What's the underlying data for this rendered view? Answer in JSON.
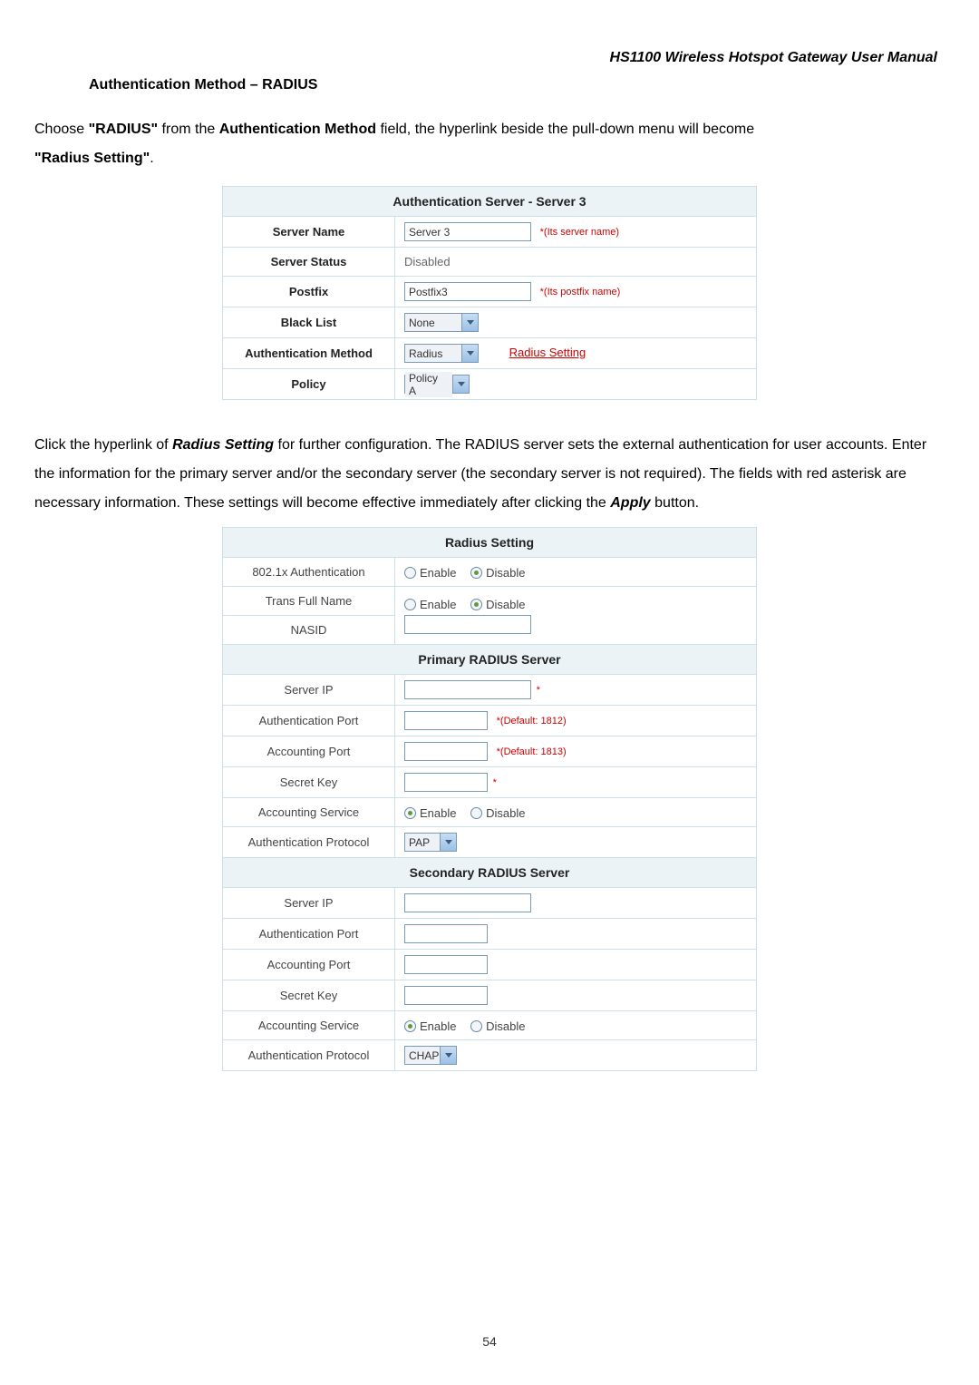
{
  "doc_title": "HS1100  Wireless  Hotspot  Gateway  User  Manual",
  "section_title": "Authentication Method – RADIUS",
  "para1_a": "Choose ",
  "para1_b": "\"RADIUS\"",
  "para1_c": " from the ",
  "para1_d": "Authentication Method",
  "para1_e": " field, the hyperlink beside the pull-down menu will become ",
  "para1_f": "\"Radius Setting\"",
  "para1_g": ".",
  "table1": {
    "header": "Authentication Server - Server 3",
    "rows": {
      "server_name_label": "Server Name",
      "server_name_value": "Server 3",
      "server_name_hint": "*(Its server name)",
      "server_status_label": "Server Status",
      "server_status_value": "Disabled",
      "postfix_label": "Postfix",
      "postfix_value": "Postfix3",
      "postfix_hint": "*(Its postfix name)",
      "black_list_label": "Black List",
      "black_list_value": "None",
      "auth_method_label": "Authentication Method",
      "auth_method_value": "Radius",
      "auth_method_link": "Radius Setting",
      "policy_label": "Policy",
      "policy_value": "Policy A"
    }
  },
  "para2_a": "Click the hyperlink of ",
  "para2_b": "Radius Setting",
  "para2_c": " for further configuration. The RADIUS server sets the external authentication for user accounts. Enter the information for the primary server and/or the secondary server (the secondary server is not required). The fields with red asterisk are necessary information. These settings will become effective immediately after clicking the ",
  "para2_d": "Apply",
  "para2_e": " button.",
  "table2": {
    "header": "Radius Setting",
    "auth_8021x_label": "802.1x Authentication",
    "enable_label": "Enable",
    "disable_label": "Disable",
    "trans_full_name_label": "Trans Full Name",
    "nasid_label": "NASID",
    "primary_header": "Primary RADIUS Server",
    "server_ip_label": "Server IP",
    "asterisk": "*",
    "auth_port_label": "Authentication Port",
    "auth_port_hint": "*(Default: 1812)",
    "acct_port_label": "Accounting Port",
    "acct_port_hint": "*(Default: 1813)",
    "secret_key_label": "Secret Key",
    "secret_key_hint": "*",
    "acct_service_label": "Accounting Service",
    "auth_protocol_label": "Authentication Protocol",
    "pap_value": "PAP",
    "secondary_header": "Secondary RADIUS Server",
    "chap_value": "CHAP"
  },
  "page_number": "54"
}
